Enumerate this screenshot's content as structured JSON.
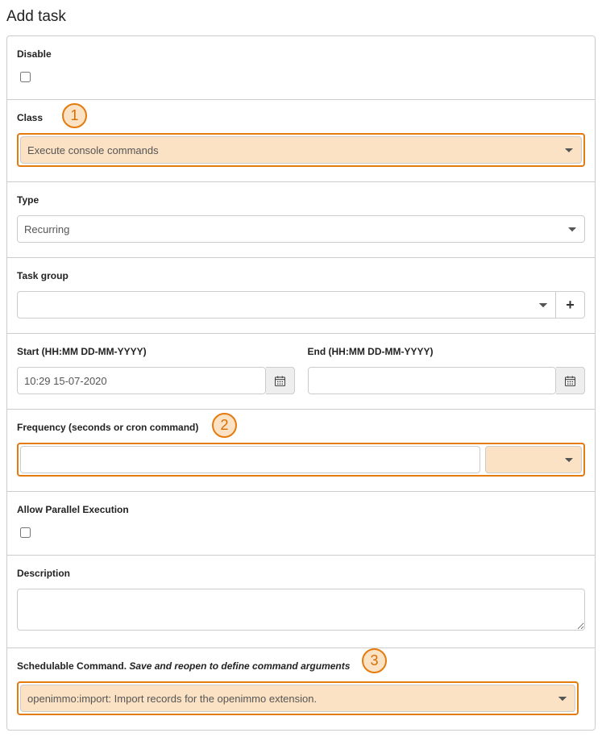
{
  "title": "Add task",
  "callouts": {
    "c1": "1",
    "c2": "2",
    "c3": "3"
  },
  "disable": {
    "label": "Disable",
    "checked": false
  },
  "class_field": {
    "label": "Class",
    "selected": "Execute console commands"
  },
  "type_field": {
    "label": "Type",
    "selected": "Recurring"
  },
  "task_group": {
    "label": "Task group",
    "selected": "",
    "add_label": "+"
  },
  "start": {
    "label": "Start (HH:MM DD-MM-YYYY)",
    "value": "10:29 15-07-2020"
  },
  "end": {
    "label": "End (HH:MM DD-MM-YYYY)",
    "value": ""
  },
  "frequency": {
    "label": "Frequency (seconds or cron command)",
    "value": "",
    "preset": ""
  },
  "parallel": {
    "label": "Allow Parallel Execution",
    "checked": false
  },
  "description": {
    "label": "Description",
    "value": ""
  },
  "command": {
    "label_main": "Schedulable Command. ",
    "label_hint": "Save and reopen to define command arguments",
    "selected": "openimmo:import: Import records for the openimmo extension."
  }
}
